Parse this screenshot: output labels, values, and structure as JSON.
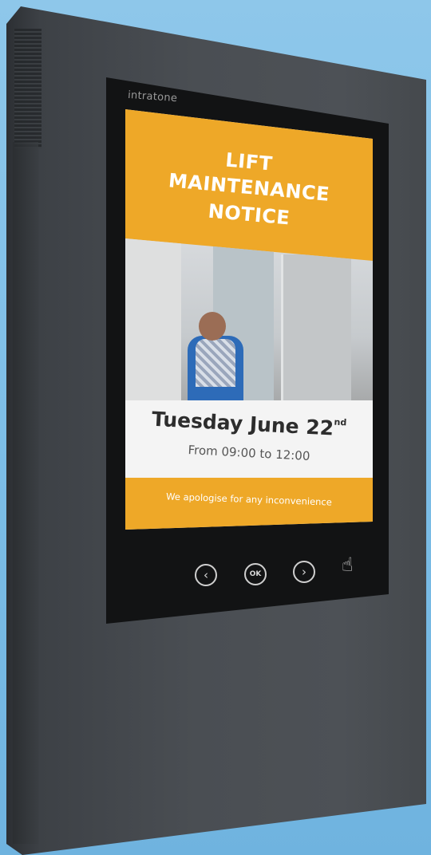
{
  "device": {
    "brand": "intratone",
    "notice": {
      "title_lines": [
        "LIFT",
        "MAINTENANCE",
        "NOTICE"
      ],
      "date_main": "Tuesday June 22",
      "date_suffix": "nd",
      "time_range": "From 09:00 to 12:00",
      "apology": "We apologise for any inconvenience"
    },
    "buttons": {
      "prev_symbol": "‹",
      "ok_label": "OK",
      "next_symbol": "›",
      "hand_symbol": "☝"
    }
  }
}
